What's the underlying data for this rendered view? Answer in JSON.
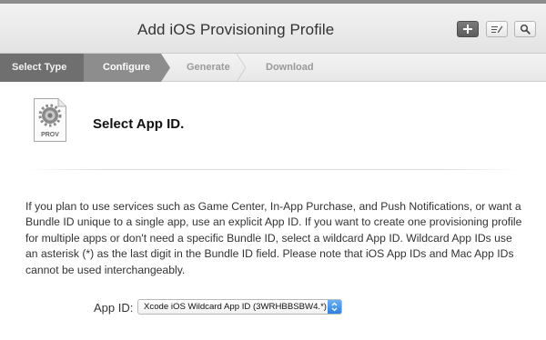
{
  "header": {
    "title": "Add iOS Provisioning Profile",
    "buttons": [
      "plus-icon",
      "edit-icon",
      "search-icon"
    ]
  },
  "steps": [
    {
      "label": "Select Type",
      "state": "completed"
    },
    {
      "label": "Configure",
      "state": "active"
    },
    {
      "label": "Generate",
      "state": "pending"
    },
    {
      "label": "Download",
      "state": "pending"
    }
  ],
  "main": {
    "icon_label": "PROV",
    "section_title": "Select App ID.",
    "description": "If you plan to use services such as Game Center, In-App Purchase, and Push Notifications, or want a Bundle ID unique to a single app, use an explicit App ID. If you want to create one provisioning profile for multiple apps or don't need a specific Bundle ID, select a wildcard App ID. Wildcard App IDs use an asterisk (*) as the last digit in the Bundle ID field. Please note that iOS App IDs and Mac App IDs cannot be used interchangeably.",
    "app_id": {
      "label": "App ID:",
      "selected_value": "Xcode iOS Wildcard App ID (3WRHBBSBW4.*)"
    }
  },
  "colors": {
    "step_completed": "#6f6f6f",
    "step_active": "#8d8d8d",
    "step_pending_text": "#9a9a9a",
    "select_accent": "#2f7fe0"
  }
}
